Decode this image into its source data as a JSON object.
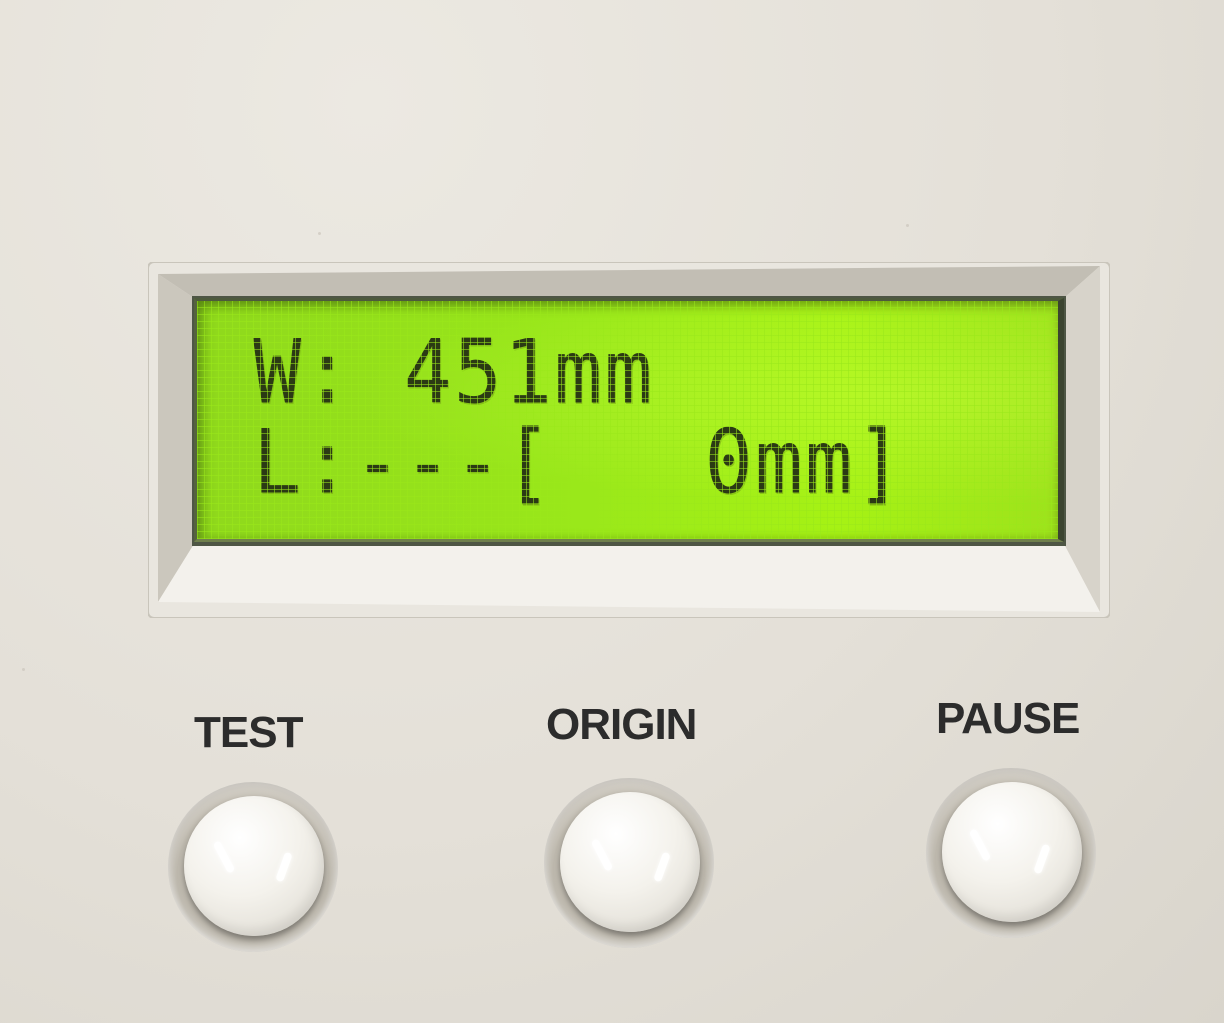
{
  "lcd": {
    "line1": "W: 451mm",
    "line2": "L:---[   0mm]"
  },
  "buttons": {
    "test_label": "TEST",
    "origin_label": "ORIGIN",
    "pause_label": "PAUSE"
  },
  "colors": {
    "lcd_backlight": "#9ae81a",
    "lcd_text": "#2b3a14",
    "panel": "#e4e0d8",
    "label_text": "#2c2c2c"
  }
}
